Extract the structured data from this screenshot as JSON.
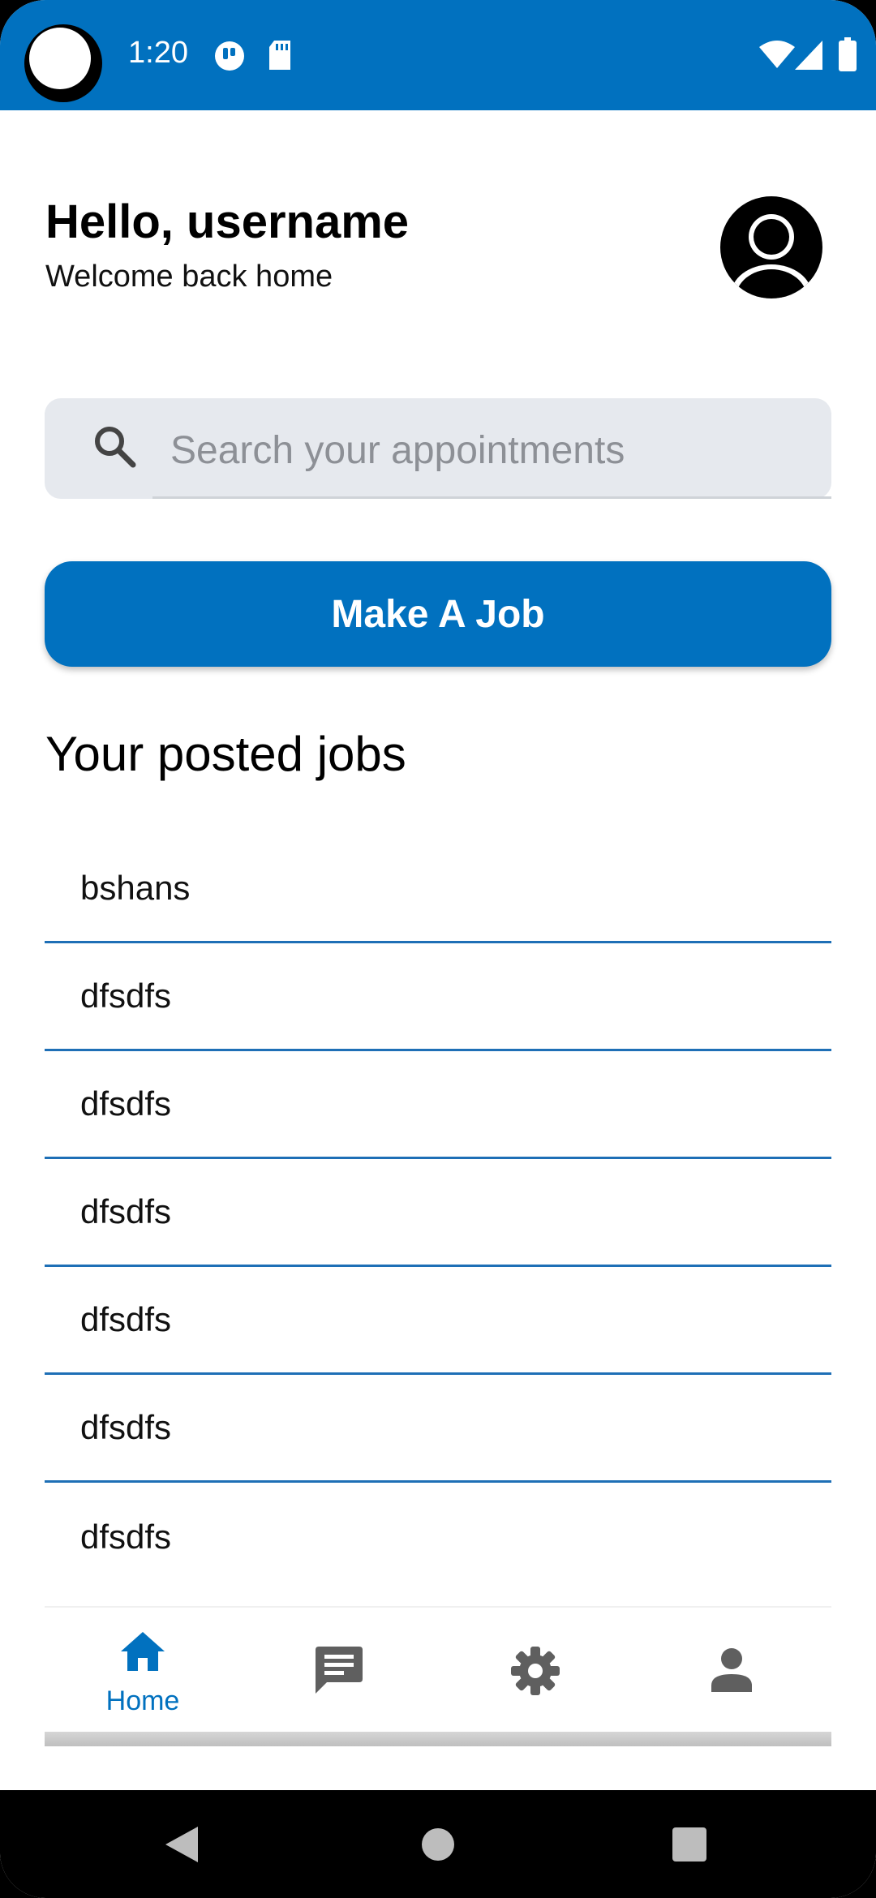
{
  "status_bar": {
    "time": "1:20"
  },
  "header": {
    "greeting": "Hello, username",
    "subtitle": "Welcome back home"
  },
  "search": {
    "placeholder": "Search your appointments"
  },
  "actions": {
    "make_job_label": "Make A Job"
  },
  "jobs": {
    "title": "Your posted jobs",
    "items": [
      "bshans",
      "dfsdfs",
      "dfsdfs",
      "dfsdfs",
      "dfsdfs",
      "dfsdfs",
      "dfsdfs"
    ]
  },
  "bottom_nav": {
    "items": [
      {
        "icon": "home-icon",
        "label": "Home",
        "active": true
      },
      {
        "icon": "chat-icon",
        "label": "",
        "active": false
      },
      {
        "icon": "settings-icon",
        "label": "",
        "active": false
      },
      {
        "icon": "person-icon",
        "label": "",
        "active": false
      }
    ]
  },
  "colors": {
    "accent": "#0171BF",
    "divider": "#1E6FB6",
    "search_bg": "#E6E9EE"
  }
}
